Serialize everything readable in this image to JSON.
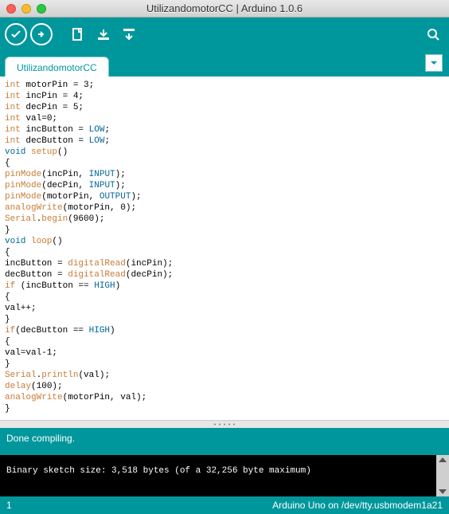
{
  "window": {
    "title": "UtilizandomotorCC | Arduino 1.0.6"
  },
  "tab": {
    "label": "UtilizandomotorCC"
  },
  "code": {
    "l1_t": "int",
    "l1_r": " motorPin = 3;",
    "l2_t": "int",
    "l2_r": " incPin = 4;",
    "l3_t": "int",
    "l3_r": " decPin = 5;",
    "l4_t": "int",
    "l4_r": " val=0;",
    "l5_t": "int",
    "l5_m": " incButton = ",
    "l5_c": "LOW",
    "l5_e": ";",
    "l6_t": "int",
    "l6_m": " decButton = ",
    "l6_c": "LOW",
    "l6_e": ";",
    "l7_v": "void",
    "l7_f": " setup",
    "l7_r": "()",
    "l8": "{",
    "l9_f": "pinMode",
    "l9_m": "(incPin, ",
    "l9_c": "INPUT",
    "l9_e": ");",
    "l10_f": "pinMode",
    "l10_m": "(decPin, ",
    "l10_c": "INPUT",
    "l10_e": ");",
    "l11_f": "pinMode",
    "l11_m": "(motorPin, ",
    "l11_c": "OUTPUT",
    "l11_e": ");",
    "l12_f": "analogWrite",
    "l12_r": "(motorPin, 0);",
    "l13_s": "Serial",
    "l13_d": ".",
    "l13_m": "begin",
    "l13_r": "(9600);",
    "l14": "}",
    "l15_v": "void",
    "l15_f": " loop",
    "l15_r": "()",
    "l16": "{",
    "l17_a": "incButton = ",
    "l17_f": "digitalRead",
    "l17_r": "(incPin);",
    "l18_a": "decButton = ",
    "l18_f": "digitalRead",
    "l18_r": "(decPin);",
    "l19_k": "if",
    "l19_m": " (incButton == ",
    "l19_c": "HIGH",
    "l19_e": ")",
    "l20": "{",
    "l21": "val++;",
    "l22": "}",
    "l23_k": "if",
    "l23_m": "(decButton == ",
    "l23_c": "HIGH",
    "l23_e": ")",
    "l24": "{",
    "l25": "val=val-1;",
    "l26": "}",
    "l27_s": "Serial",
    "l27_d": ".",
    "l27_m": "println",
    "l27_r": "(val);",
    "l28_f": "delay",
    "l28_r": "(100);",
    "l29_f": "analogWrite",
    "l29_r": "(motorPin, val);",
    "l30": "}"
  },
  "status": {
    "message": "Done compiling."
  },
  "console": {
    "text": "Binary sketch size: 3,518 bytes (of a 32,256 byte maximum)"
  },
  "footer": {
    "line": "1",
    "board": "Arduino Uno on /dev/tty.usbmodem1a21"
  }
}
